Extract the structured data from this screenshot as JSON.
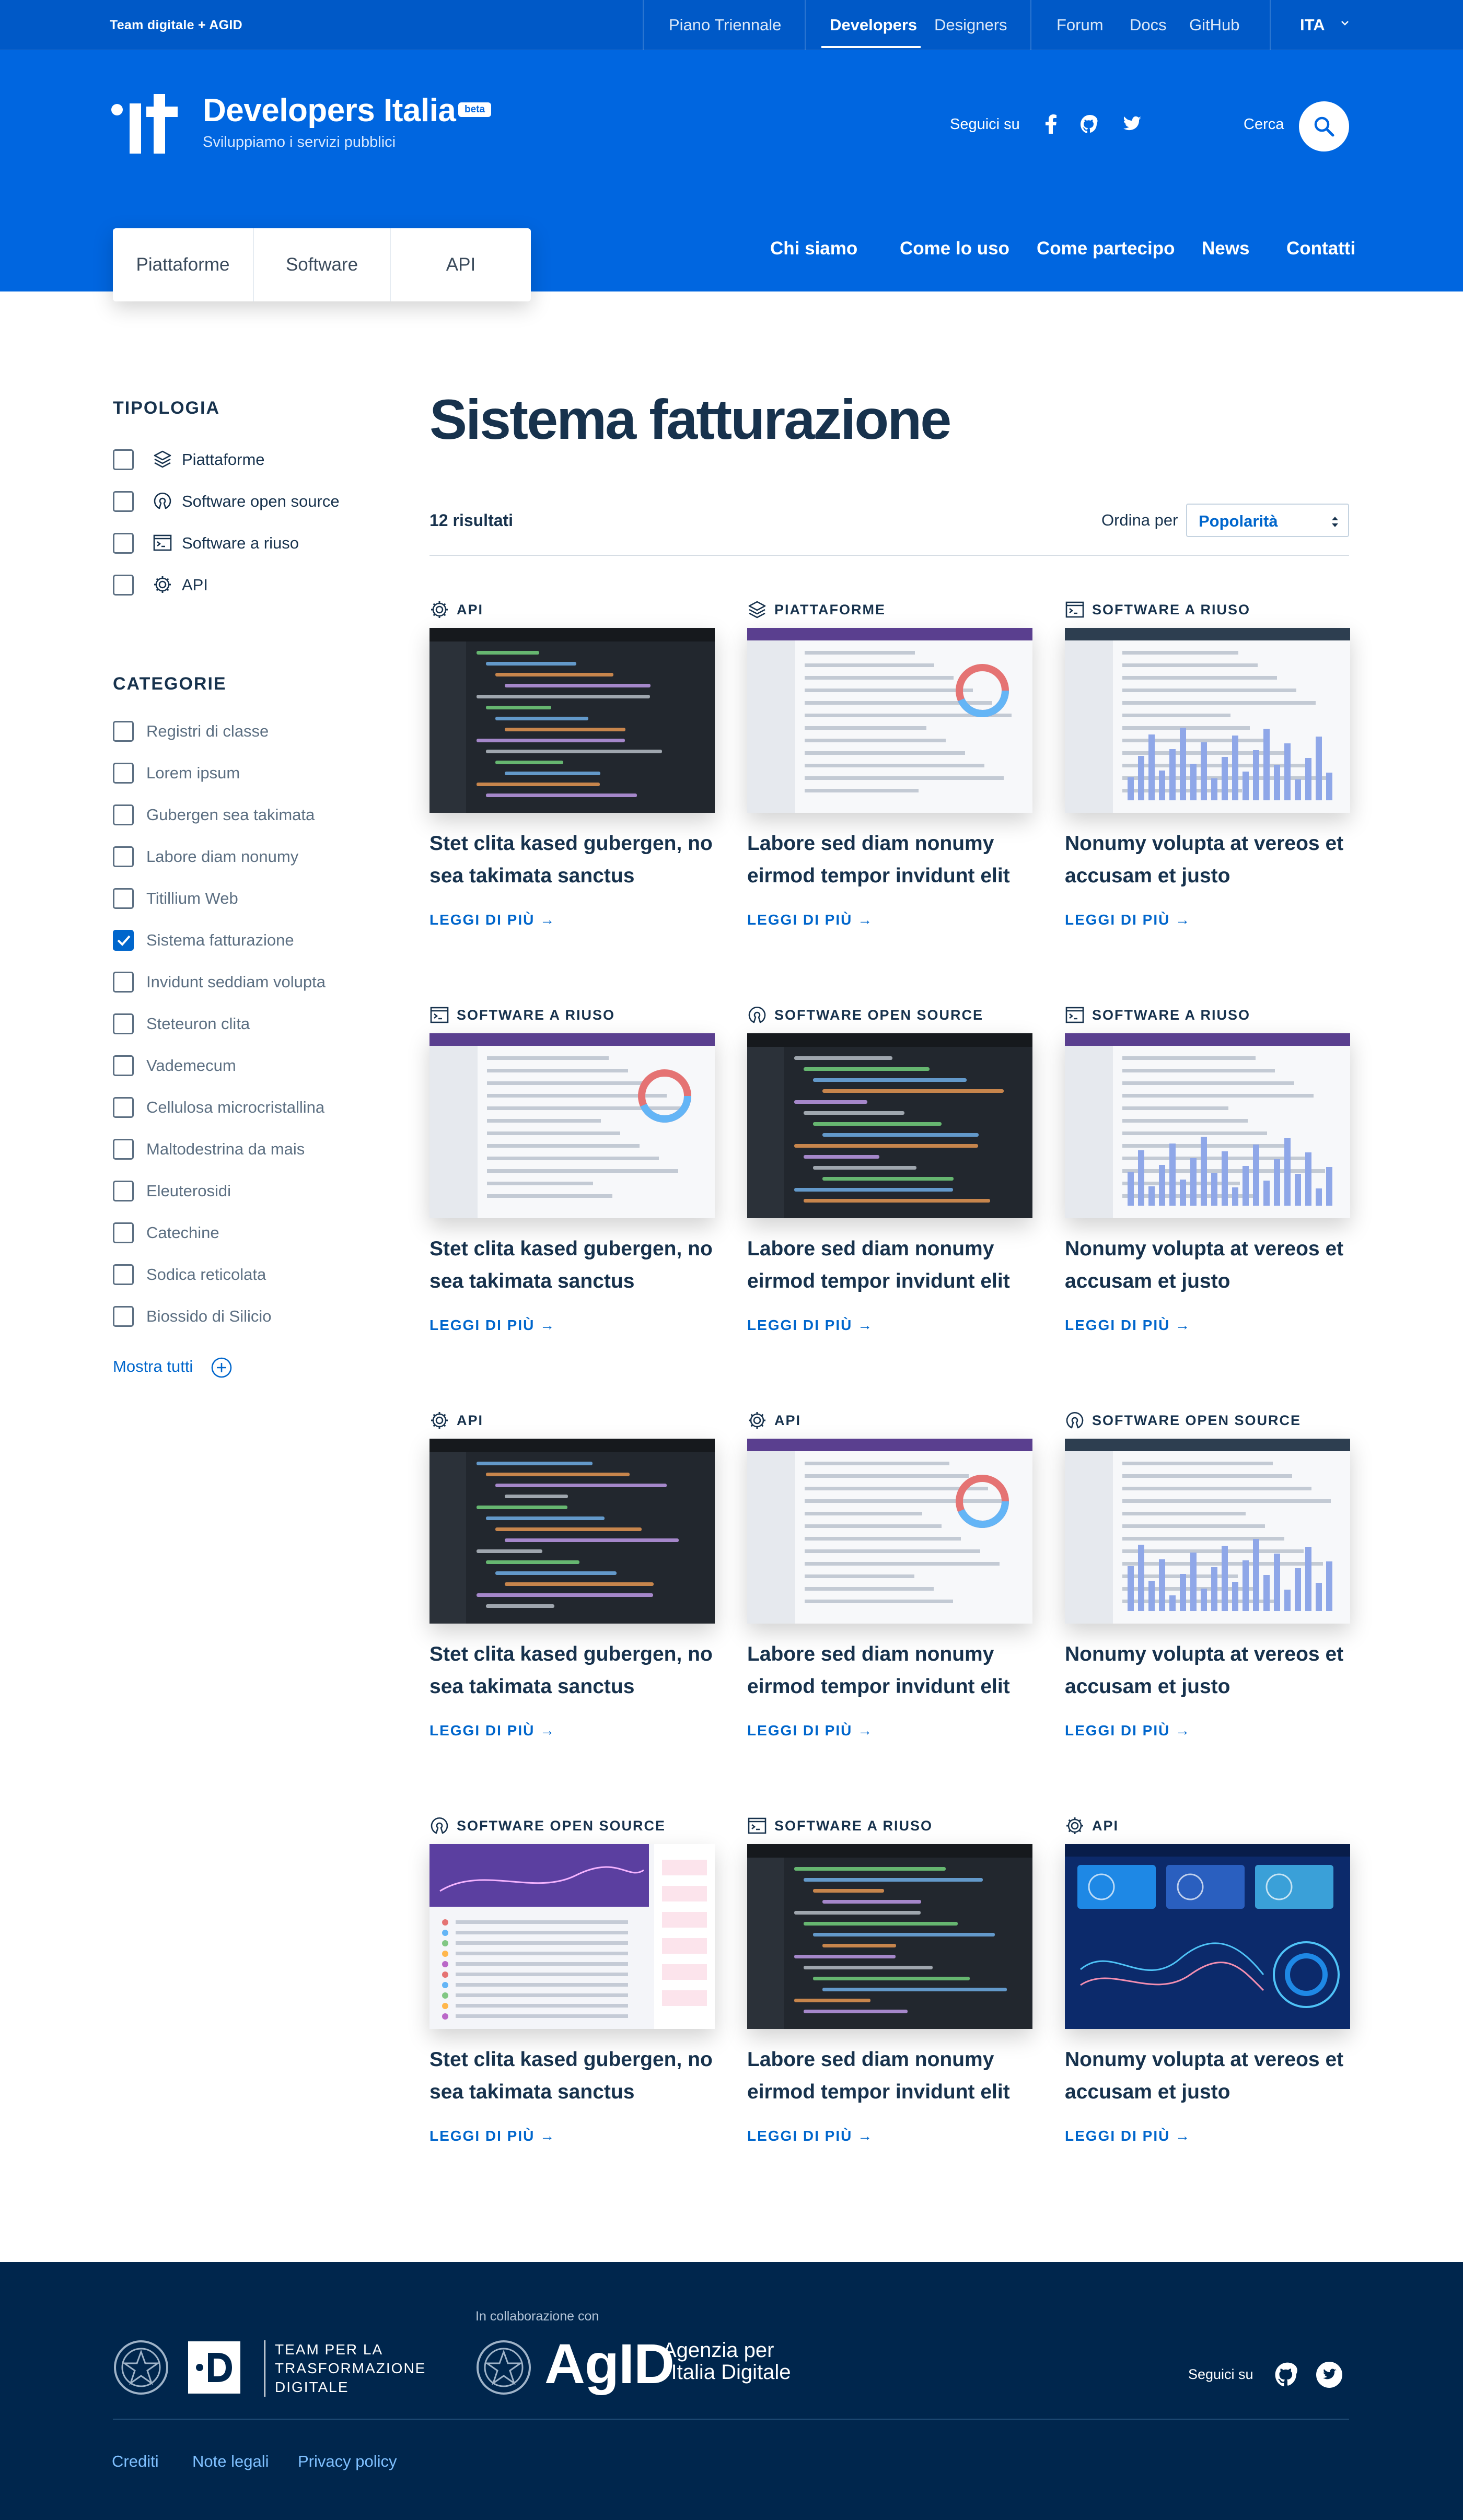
{
  "topbar": {
    "brand": "Team digitale + AGID",
    "links": [
      "Piano Triennale",
      "Developers",
      "Designers",
      "Forum",
      "Docs",
      "GitHub"
    ],
    "active": "Developers",
    "lang": "ITA"
  },
  "header": {
    "title": "Developers Italia",
    "badge": "beta",
    "subtitle": "Sviluppiamo i servizi pubblici",
    "follow": "Seguici su",
    "search_label": "Cerca",
    "tabs": [
      "Piattaforme",
      "Software",
      "API"
    ],
    "nav": [
      "Chi siamo",
      "Come lo uso",
      "Come partecipo",
      "News",
      "Contatti"
    ]
  },
  "sidebar": {
    "tipologia_title": "TIPOLOGIA",
    "tipologia": [
      {
        "label": "Piattaforme",
        "icon": "layers-icon"
      },
      {
        "label": "Software open source",
        "icon": "open-source-icon"
      },
      {
        "label": "Software a riuso",
        "icon": "terminal-icon"
      },
      {
        "label": "API",
        "icon": "gear-icon"
      }
    ],
    "categorie_title": "CATEGORIE",
    "categorie": [
      {
        "label": "Registri di classe",
        "checked": false
      },
      {
        "label": "Lorem ipsum",
        "checked": false
      },
      {
        "label": "Gubergen sea takimata",
        "checked": false
      },
      {
        "label": "Labore diam nonumy",
        "checked": false
      },
      {
        "label": "Titillium Web",
        "checked": false
      },
      {
        "label": "Sistema fatturazione",
        "checked": true
      },
      {
        "label": "Invidunt seddiam volupta",
        "checked": false
      },
      {
        "label": "Steteuron clita",
        "checked": false
      },
      {
        "label": "Vademecum",
        "checked": false
      },
      {
        "label": "Cellulosa microcristallina",
        "checked": false
      },
      {
        "label": "Maltodestrina da mais",
        "checked": false
      },
      {
        "label": "Eleuterosidi",
        "checked": false
      },
      {
        "label": "Catechine",
        "checked": false
      },
      {
        "label": "Sodica reticolata",
        "checked": false
      },
      {
        "label": "Biossido di Silicio",
        "checked": false
      }
    ],
    "show_all": "Mostra tutti"
  },
  "main": {
    "title": "Sistema fatturazione",
    "results": "12 risultati",
    "order_label": "Ordina per",
    "order_value": "Popolarità",
    "read_more": "LEGGI DI PIÙ →",
    "cards": [
      {
        "category": "API",
        "icon": "gear-icon",
        "title": "Stet clita kased gubergen, no sea takimata sanctus",
        "thumb": "dark"
      },
      {
        "category": "PIATTAFORME",
        "icon": "layers-icon",
        "title": "Labore sed diam nonumy eirmod tempor invidunt elit",
        "thumb": "light"
      },
      {
        "category": "SOFTWARE A RIUSO",
        "icon": "terminal-icon",
        "title": "Nonumy volupta at vereos et accusam et justo",
        "thumb": "light"
      },
      {
        "category": "SOFTWARE A RIUSO",
        "icon": "terminal-icon",
        "title": "Stet clita kased gubergen, no sea takimata sanctus",
        "thumb": "light"
      },
      {
        "category": "SOFTWARE OPEN SOURCE",
        "icon": "open-source-icon",
        "title": "Labore sed diam nonumy eirmod tempor invidunt elit",
        "thumb": "dark"
      },
      {
        "category": "SOFTWARE A RIUSO",
        "icon": "terminal-icon",
        "title": "Nonumy volupta at vereos et accusam et justo",
        "thumb": "light"
      },
      {
        "category": "API",
        "icon": "gear-icon",
        "title": "Stet clita kased gubergen, no sea takimata sanctus",
        "thumb": "dark"
      },
      {
        "category": "API",
        "icon": "gear-icon",
        "title": "Labore sed diam nonumy eirmod tempor invidunt elit",
        "thumb": "light"
      },
      {
        "category": "SOFTWARE OPEN SOURCE",
        "icon": "open-source-icon",
        "title": "Nonumy volupta at vereos et accusam et justo",
        "thumb": "light"
      },
      {
        "category": "SOFTWARE OPEN SOURCE",
        "icon": "open-source-icon",
        "title": "Stet clita kased gubergen, no sea takimata sanctus",
        "thumb": "purple"
      },
      {
        "category": "SOFTWARE A RIUSO",
        "icon": "terminal-icon",
        "title": "Labore sed diam nonumy eirmod tempor invidunt elit",
        "thumb": "dark"
      },
      {
        "category": "API",
        "icon": "gear-icon",
        "title": "Nonumy volupta at vereos et accusam et justo",
        "thumb": "blue"
      }
    ]
  },
  "footer": {
    "team": "TEAM PER LA TRASFORMAZIONE DIGITALE",
    "collab": "In collaborazione con",
    "agid": "AgID",
    "agid_sub_1": "Agenzia per",
    "agid_sub_2": "l'Italia Digitale",
    "follow": "Seguici su",
    "links": [
      "Crediti",
      "Note legali",
      "Privacy policy"
    ]
  },
  "colors": {
    "primary": "#0066cc",
    "header": "#0066e0",
    "topbar": "#0059c7",
    "footer": "#00264d",
    "text": "#17324d"
  }
}
